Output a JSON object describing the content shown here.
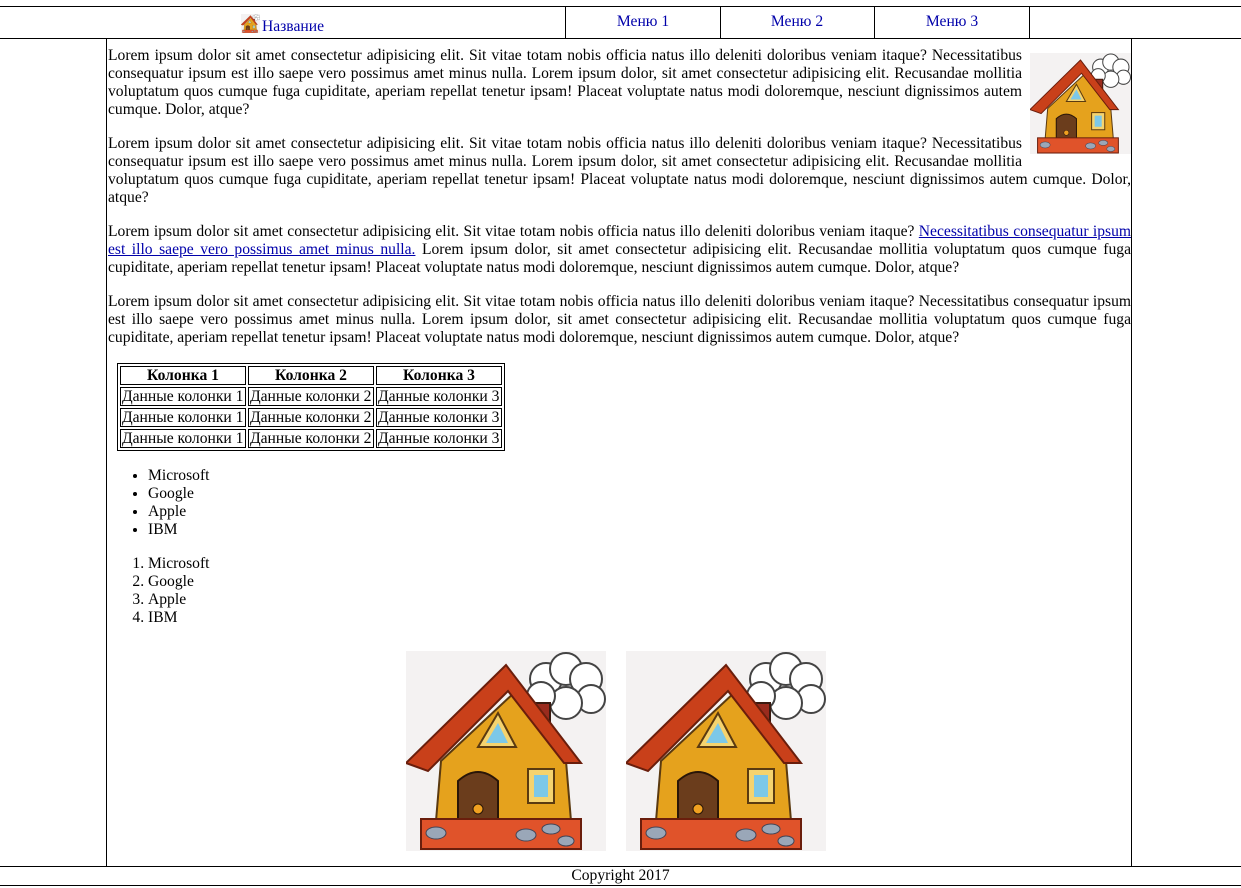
{
  "header": {
    "logo_label": "Название",
    "menu": [
      "Меню 1",
      "Меню 2",
      "Меню 3"
    ]
  },
  "paragraphs": {
    "p1": "Lorem ipsum dolor sit amet consectetur adipisicing elit. Sit vitae totam nobis officia natus illo deleniti doloribus veniam itaque? Necessitatibus consequatur ipsum est illo saepe vero possimus amet minus nulla. Lorem ipsum dolor, sit amet consectetur adipisicing elit. Recusandae mollitia voluptatum quos cumque fuga cupiditate, aperiam repellat tenetur ipsam! Placeat voluptate natus modi doloremque, nesciunt dignissimos autem cumque. Dolor, atque?",
    "p2": "Lorem ipsum dolor sit amet consectetur adipisicing elit. Sit vitae totam nobis officia natus illo deleniti doloribus veniam itaque? Necessitatibus consequatur ipsum est illo saepe vero possimus amet minus nulla. Lorem ipsum dolor, sit amet consectetur adipisicing elit. Recusandae mollitia voluptatum quos cumque fuga cupiditate, aperiam repellat tenetur ipsam! Placeat voluptate natus modi doloremque, nesciunt dignissimos autem cumque. Dolor, atque?",
    "p3_before": "Lorem ipsum dolor sit amet consectetur adipisicing elit. Sit vitae totam nobis officia natus illo deleniti doloribus veniam itaque? ",
    "p3_link": "Necessitatibus consequatur ipsum est illo saepe vero possimus amet minus nulla.",
    "p3_after": " Lorem ipsum dolor, sit amet consectetur adipisicing elit. Recusandae mollitia voluptatum quos cumque fuga cupiditate, aperiam repellat tenetur ipsam! Placeat voluptate natus modi doloremque, nesciunt dignissimos autem cumque. Dolor, atque?",
    "p4": "Lorem ipsum dolor sit amet consectetur adipisicing elit. Sit vitae totam nobis officia natus illo deleniti doloribus veniam itaque? Necessitatibus consequatur ipsum est illo saepe vero possimus amet minus nulla. Lorem ipsum dolor, sit amet consectetur adipisicing elit. Recusandae mollitia voluptatum quos cumque fuga cupiditate, aperiam repellat tenetur ipsam! Placeat voluptate natus modi doloremque, nesciunt dignissimos autem cumque. Dolor, atque?"
  },
  "table": {
    "headers": [
      "Колонка 1",
      "Колонка 2",
      "Колонка 3"
    ],
    "rows": [
      [
        "Данные колонки 1",
        "Данные колонки 2",
        "Данные колонки 3"
      ],
      [
        "Данные колонки 1",
        "Данные колонки 2",
        "Данные колонки 3"
      ],
      [
        "Данные колонки 1",
        "Данные колонки 2",
        "Данные колонки 3"
      ]
    ]
  },
  "unordered_list": [
    "Microsoft",
    "Google",
    "Apple",
    "IBM"
  ],
  "ordered_list": [
    "Microsoft",
    "Google",
    "Apple",
    "IBM"
  ],
  "images": {
    "logo_icon": "house-icon",
    "float_image": "house-image",
    "gallery": [
      "house-image",
      "house-image"
    ]
  },
  "footer": {
    "copyright": "Copyright 2017"
  }
}
